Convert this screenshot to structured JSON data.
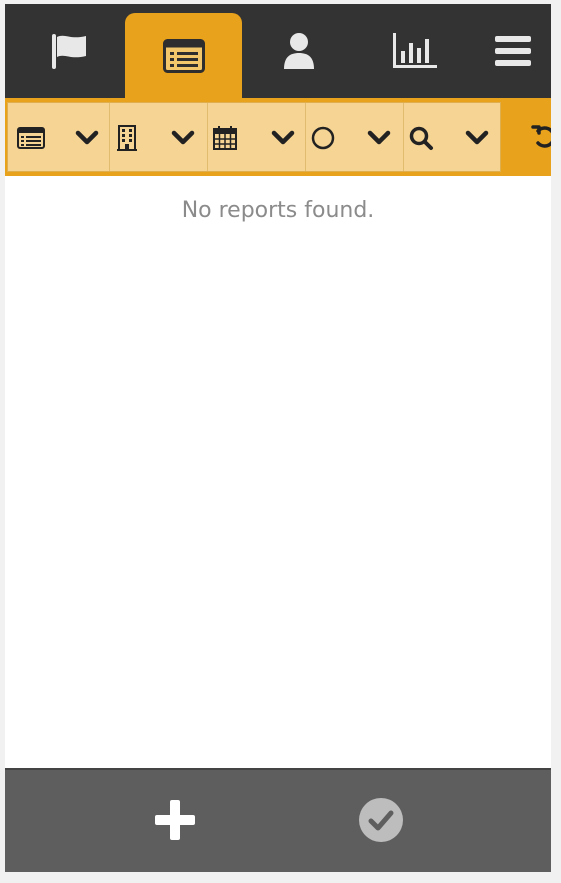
{
  "nav": {
    "items": [
      {
        "name": "flag",
        "icon": "flag-icon",
        "active": false
      },
      {
        "name": "reports",
        "icon": "list-icon",
        "active": true
      },
      {
        "name": "user",
        "icon": "user-icon",
        "active": false
      },
      {
        "name": "charts",
        "icon": "bar-chart-icon",
        "active": false
      },
      {
        "name": "menu",
        "icon": "hamburger-menu-icon",
        "active": false
      }
    ]
  },
  "filters": [
    {
      "name": "report-type",
      "icon": "list-icon"
    },
    {
      "name": "building",
      "icon": "building-icon"
    },
    {
      "name": "date",
      "icon": "calendar-icon"
    },
    {
      "name": "status",
      "icon": "circle-icon"
    },
    {
      "name": "search",
      "icon": "search-icon"
    }
  ],
  "content": {
    "empty_message": "No reports found."
  },
  "bottom": {
    "add_icon": "plus-icon",
    "submit_icon": "check-circle-icon"
  },
  "colors": {
    "nav_bg": "#333333",
    "accent": "#e9a21c",
    "filter_bg": "#f6d494",
    "bottom_bg": "#5e5e5e",
    "text_muted": "#8b8b8b"
  }
}
